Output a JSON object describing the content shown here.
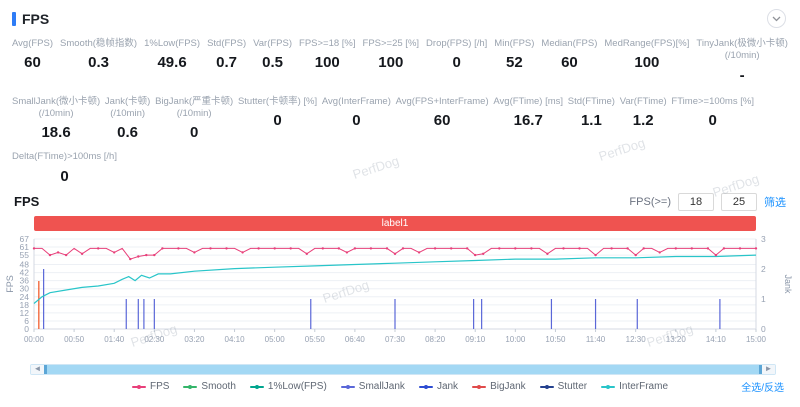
{
  "colors": {
    "accent": "#1890ff",
    "header_bar": "#2e7cf6",
    "banner": "#ef5350",
    "scrollbar": "#a3d8f4"
  },
  "panel": {
    "title": "FPS"
  },
  "watermark": "PerfDog",
  "stats": {
    "row1": [
      {
        "label": "Avg(FPS)",
        "value": "60"
      },
      {
        "label": "Smooth(稳帧指数)",
        "value": "0.3"
      },
      {
        "label": "1%Low(FPS)",
        "value": "49.6"
      },
      {
        "label": "Std(FPS)",
        "value": "0.7"
      },
      {
        "label": "Var(FPS)",
        "value": "0.5"
      },
      {
        "label": "FPS>=18 [%]",
        "value": "100"
      },
      {
        "label": "FPS>=25 [%]",
        "value": "100"
      },
      {
        "label": "Drop(FPS) [/h]",
        "value": "0"
      },
      {
        "label": "Min(FPS)",
        "value": "52"
      },
      {
        "label": "Median(FPS)",
        "value": "60"
      },
      {
        "label": "MedRange(FPS)[%]",
        "value": "100"
      },
      {
        "label": "TinyJank(极微小卡顿)",
        "sub": "(/10min)",
        "value": "-"
      }
    ],
    "row2": [
      {
        "label": "SmallJank(微小卡顿)",
        "sub": "(/10min)",
        "value": "18.6"
      },
      {
        "label": "Jank(卡顿)",
        "sub": "(/10min)",
        "value": "0.6"
      },
      {
        "label": "BigJank(严重卡顿)",
        "sub": "(/10min)",
        "value": "0"
      },
      {
        "label": "Stutter(卡顿率) [%]",
        "value": "0"
      },
      {
        "label": "Avg(InterFrame)",
        "value": "0"
      },
      {
        "label": "Avg(FPS+InterFrame)",
        "value": "60"
      },
      {
        "label": "Avg(FTime) [ms]",
        "value": "16.7"
      },
      {
        "label": "Std(FTime)",
        "value": "1.1"
      },
      {
        "label": "Var(FTime)",
        "value": "1.2"
      },
      {
        "label": "FTime>=100ms [%]",
        "value": "0"
      }
    ],
    "row3": [
      {
        "label": "Delta(FTime)>100ms [/h]",
        "value": "0"
      }
    ]
  },
  "chart_header": {
    "title": "FPS",
    "threshold_label": "FPS(>=)",
    "input1": "18",
    "input2": "25",
    "filter_label": "筛选"
  },
  "banner": {
    "text": "label1",
    "color": "#ef5350"
  },
  "legend": [
    {
      "label": "FPS",
      "color": "#e8407a"
    },
    {
      "label": "Smooth",
      "color": "#34b56a"
    },
    {
      "label": "1%Low(FPS)",
      "color": "#00a58e"
    },
    {
      "label": "SmallJank",
      "color": "#5a67d8"
    },
    {
      "label": "Jank",
      "color": "#2d4cd2"
    },
    {
      "label": "BigJank",
      "color": "#e04b4b"
    },
    {
      "label": "Stutter",
      "color": "#24418e"
    },
    {
      "label": "InterFrame",
      "color": "#29c5c9"
    }
  ],
  "footer": {
    "select_all": "全选/反选"
  },
  "scrollbar": {
    "left_arrow": "◄",
    "right_arrow": "►"
  },
  "chart_data": {
    "type": "line",
    "title": "label1",
    "x_tick_labels": [
      "00:00",
      "00:50",
      "01:40",
      "02:30",
      "03:20",
      "04:10",
      "05:00",
      "05:50",
      "06:40",
      "07:30",
      "08:20",
      "09:10",
      "10:00",
      "10:50",
      "11:40",
      "12:30",
      "13:20",
      "14:10",
      "15:00"
    ],
    "x_tick_interval_s": 50,
    "x_max_s": 900,
    "y_left": {
      "label": "FPS",
      "max": 67,
      "ticks": [
        67,
        61,
        55,
        48,
        42,
        36,
        30,
        24,
        18,
        12,
        6,
        0
      ]
    },
    "y_right": {
      "label": "Jank",
      "max": 3,
      "ticks": [
        3,
        2,
        1,
        0
      ]
    },
    "series_colors": {
      "fps": "#e8407a",
      "smooth": "#34b56a",
      "low1": "#00a58e",
      "smalljank": "#5a67d8",
      "jank": "#2d4cd2",
      "bigjank": "#f2683c",
      "stutter": "#24418e",
      "interframe": "#29c5c9"
    },
    "fps": {
      "baseline": 60,
      "sample_step_s": 10,
      "dips": [
        [
          20,
          55
        ],
        [
          30,
          57
        ],
        [
          40,
          55
        ],
        [
          60,
          56
        ],
        [
          100,
          57
        ],
        [
          120,
          52
        ],
        [
          130,
          54
        ],
        [
          140,
          55
        ],
        [
          150,
          55
        ],
        [
          200,
          57
        ],
        [
          260,
          57
        ],
        [
          340,
          56
        ],
        [
          390,
          57
        ],
        [
          450,
          56
        ],
        [
          480,
          57
        ],
        [
          550,
          55
        ],
        [
          560,
          56
        ],
        [
          640,
          56
        ],
        [
          700,
          55
        ],
        [
          750,
          55
        ],
        [
          780,
          57
        ],
        [
          850,
          55
        ]
      ]
    },
    "interframe_points": [
      [
        0,
        19
      ],
      [
        10,
        24
      ],
      [
        20,
        27
      ],
      [
        40,
        29
      ],
      [
        60,
        31
      ],
      [
        80,
        32
      ],
      [
        100,
        34
      ],
      [
        110,
        37
      ],
      [
        118,
        39
      ],
      [
        126,
        36
      ],
      [
        134,
        40
      ],
      [
        144,
        38
      ],
      [
        155,
        41
      ],
      [
        170,
        41
      ],
      [
        200,
        43
      ],
      [
        250,
        45
      ],
      [
        300,
        46
      ],
      [
        350,
        47
      ],
      [
        400,
        48
      ],
      [
        450,
        49
      ],
      [
        500,
        50
      ],
      [
        550,
        51
      ],
      [
        600,
        52
      ],
      [
        650,
        52
      ],
      [
        700,
        53
      ],
      [
        750,
        53
      ],
      [
        800,
        54
      ],
      [
        850,
        54
      ],
      [
        900,
        55
      ]
    ],
    "smalljank_spikes": [
      [
        12,
        2
      ],
      [
        115,
        1
      ],
      [
        130,
        1
      ],
      [
        137,
        1
      ],
      [
        150,
        1
      ],
      [
        345,
        1
      ],
      [
        450,
        1
      ],
      [
        548,
        1
      ],
      [
        558,
        1
      ],
      [
        645,
        1
      ],
      [
        700,
        1
      ],
      [
        752,
        1
      ],
      [
        855,
        1
      ]
    ],
    "bigjank_spikes": [
      [
        6,
        1.6
      ]
    ]
  }
}
